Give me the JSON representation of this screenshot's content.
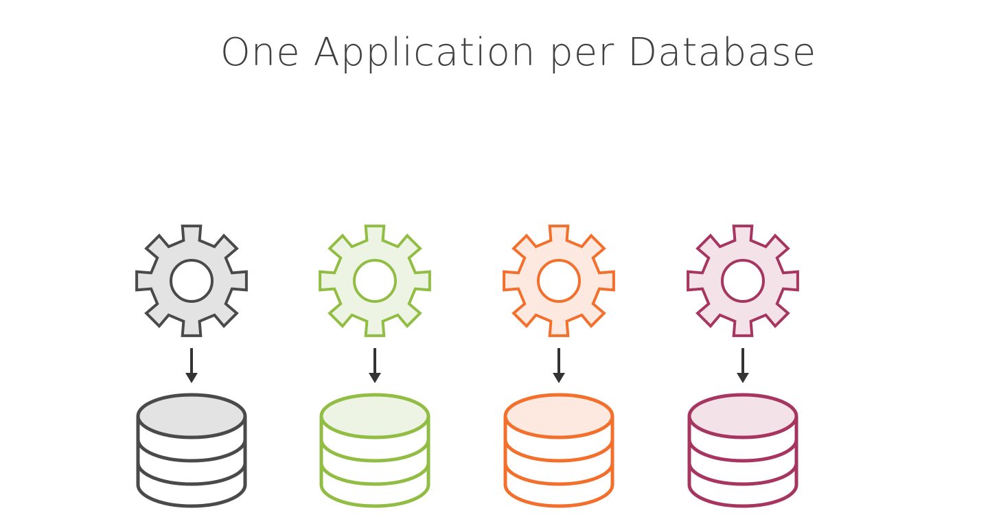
{
  "title": "One Application per Database",
  "pairs": [
    {
      "stroke": "#4a4a4a",
      "fill": "#e3e3e3"
    },
    {
      "stroke": "#92bd44",
      "fill": "#eef4e4"
    },
    {
      "stroke": "#f26f2c",
      "fill": "#fde9df"
    },
    {
      "stroke": "#a6365f",
      "fill": "#f3e2e8"
    }
  ],
  "arrow_color": "#333333",
  "icons": {
    "app": "gear-icon",
    "db": "database-icon",
    "arrow": "arrow-down-icon"
  }
}
